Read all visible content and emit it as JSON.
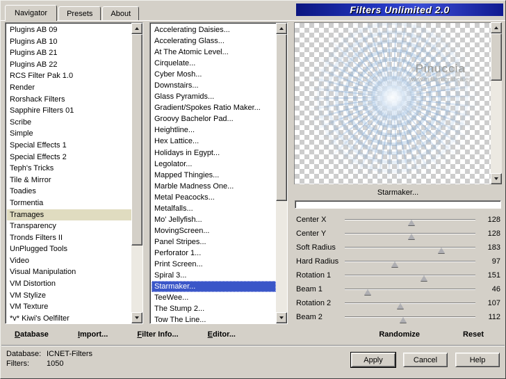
{
  "window": {
    "title": "Filters Unlimited 2.0"
  },
  "tabs": [
    {
      "label": "Navigator",
      "active": true
    },
    {
      "label": "Presets",
      "active": false
    },
    {
      "label": "About",
      "active": false
    }
  ],
  "categories": {
    "selected": "Tramages",
    "items": [
      "Plugins AB 09",
      "Plugins AB 10",
      "Plugins AB 21",
      "Plugins AB 22",
      "RCS Filter Pak 1.0",
      "Render",
      "Rorshack Filters",
      "Sapphire Filters 01",
      "Scribe",
      "Simple",
      "Special Effects 1",
      "Special Effects 2",
      "Teph's Tricks",
      "Tile & Mirror",
      "Toadies",
      "Tormentia",
      "Tramages",
      "Transparency",
      "Tronds Filters II",
      "UnPlugged Tools",
      "Video",
      "Visual Manipulation",
      "VM Distortion",
      "VM Stylize",
      "VM Texture",
      "*v* Kiwi's Oelfilter"
    ]
  },
  "filters": {
    "selected": "Starmaker...",
    "items": [
      "Accelerating Daisies...",
      "Accelerating Glass...",
      "At The Atomic Level...",
      "Cirquelate...",
      "Cyber Mosh...",
      "Downstairs...",
      "Glass Pyramids...",
      "Gradient/Spokes Ratio Maker...",
      "Groovy Bachelor Pad...",
      "Heightline...",
      "Hex Lattice...",
      "Holidays in Egypt...",
      "Legolator...",
      "Mapped Thingies...",
      "Marble Madness One...",
      "Metal Peacocks...",
      "Metalfalls...",
      "Mo' Jellyfish...",
      "MovingScreen...",
      "Panel Stripes...",
      "Perforator 1...",
      "Print Screen...",
      "Spiral 3...",
      "Starmaker...",
      "TeeWee...",
      "The Stump 2...",
      "Tow The Line..."
    ]
  },
  "preview": {
    "label": "Starmaker...",
    "progress_pct": 0
  },
  "params": [
    {
      "label": "Center X",
      "value": 128,
      "pos_pct": 50
    },
    {
      "label": "Center Y",
      "value": 128,
      "pos_pct": 50
    },
    {
      "label": "Soft Radius",
      "value": 183,
      "pos_pct": 72
    },
    {
      "label": "Hard Radius",
      "value": 97,
      "pos_pct": 38
    },
    {
      "label": "Rotation 1",
      "value": 151,
      "pos_pct": 59
    },
    {
      "label": "Beam 1",
      "value": 46,
      "pos_pct": 18
    },
    {
      "label": "Rotation 2",
      "value": 107,
      "pos_pct": 42
    },
    {
      "label": "Beam 2",
      "value": 112,
      "pos_pct": 44
    }
  ],
  "watermark": {
    "name": "Pinuccia",
    "url": "www.maidiregrafica.eu"
  },
  "toolbar": {
    "database": "Database",
    "import": "Import...",
    "filter_info": "Filter Info...",
    "editor": "Editor...",
    "randomize": "Randomize",
    "reset": "Reset"
  },
  "status": {
    "db_label": "Database:",
    "db_value": "ICNET-Filters",
    "filters_label": "Filters:",
    "filters_value": "1050"
  },
  "dialog_buttons": {
    "apply": "Apply",
    "cancel": "Cancel",
    "help": "Help"
  },
  "colors": {
    "dialog_bg": "#d4d0c8",
    "title_blue": "#2336c0",
    "selection_blue": "#3a56c8",
    "selection_soft": "#e0dcc0"
  }
}
